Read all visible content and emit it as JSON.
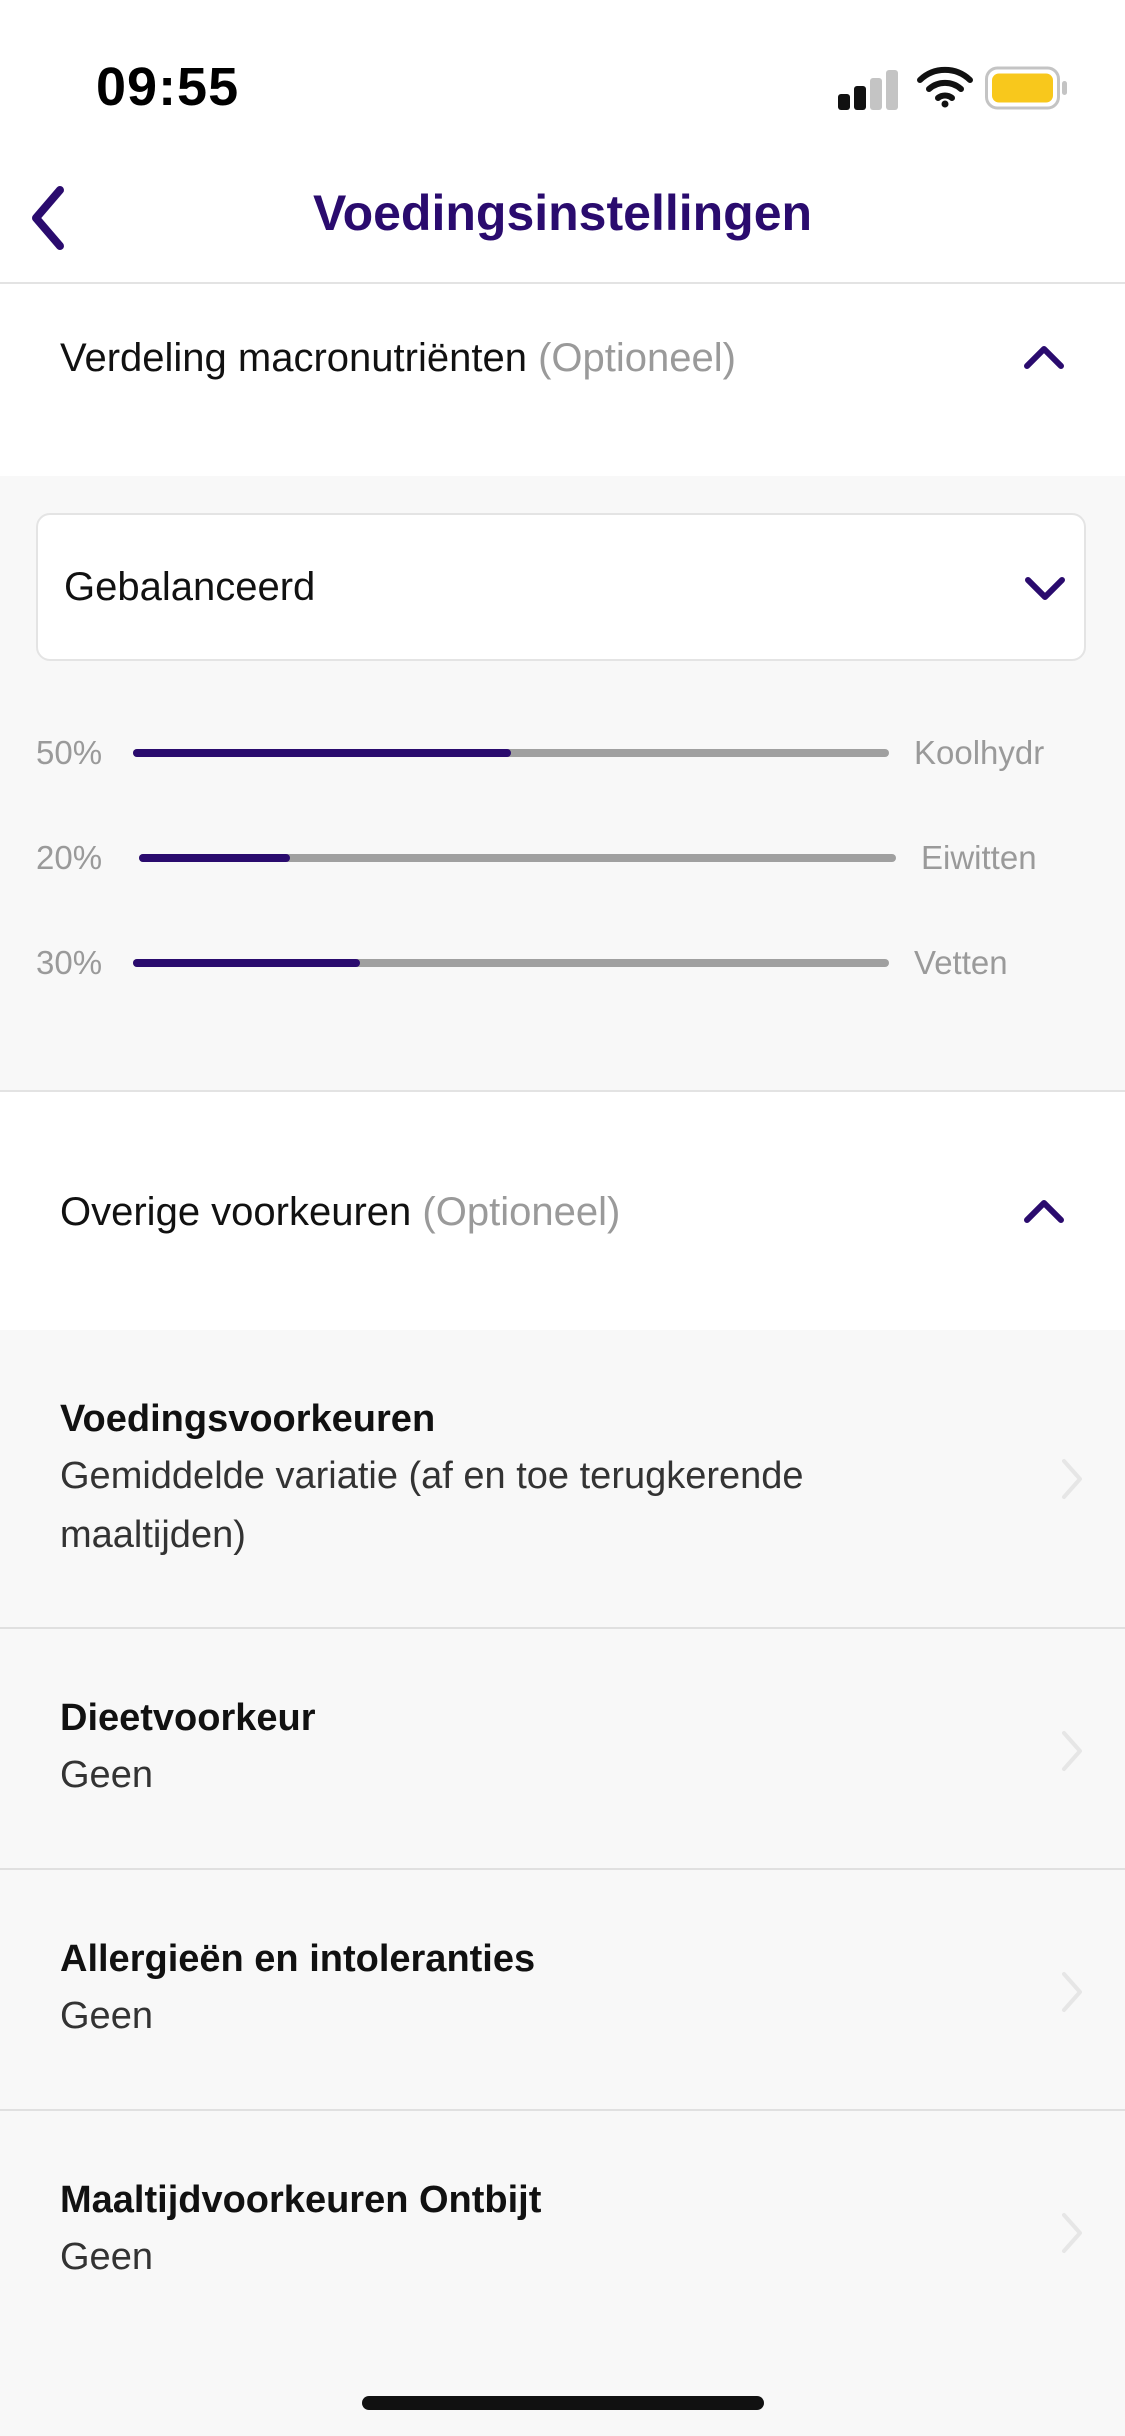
{
  "status_bar": {
    "time": "09:55",
    "battery_color": "#f8c81c"
  },
  "header": {
    "title": "Voedingsinstellingen",
    "back_icon": "chevron-left-icon"
  },
  "macros_section": {
    "title": "Verdeling macronutriënten",
    "optional": "(Optioneel)",
    "selected_preset": "Gebalanceerd",
    "items": [
      {
        "percent_label": "50%",
        "fraction": 0.5,
        "label": "Koolhydr"
      },
      {
        "percent_label": "20%",
        "fraction": 0.2,
        "label": "Eiwitten"
      },
      {
        "percent_label": "30%",
        "fraction": 0.3,
        "label": "Vetten"
      }
    ]
  },
  "other_section": {
    "title": "Overige voorkeuren",
    "optional": "(Optioneel)"
  },
  "preferences": [
    {
      "title": "Voedingsvoorkeuren",
      "value": "Gemiddelde variatie (af en toe terugkerende maaltijden)"
    },
    {
      "title": "Dieetvoorkeur",
      "value": "Geen"
    },
    {
      "title": "Allergieën en intoleranties",
      "value": "Geen"
    },
    {
      "title": "Maaltijdvoorkeuren Ontbijt",
      "value": "Geen"
    }
  ],
  "colors": {
    "accent": "#2a0b6e",
    "muted": "#9a9a9a",
    "panel": "#f8f8f8"
  }
}
